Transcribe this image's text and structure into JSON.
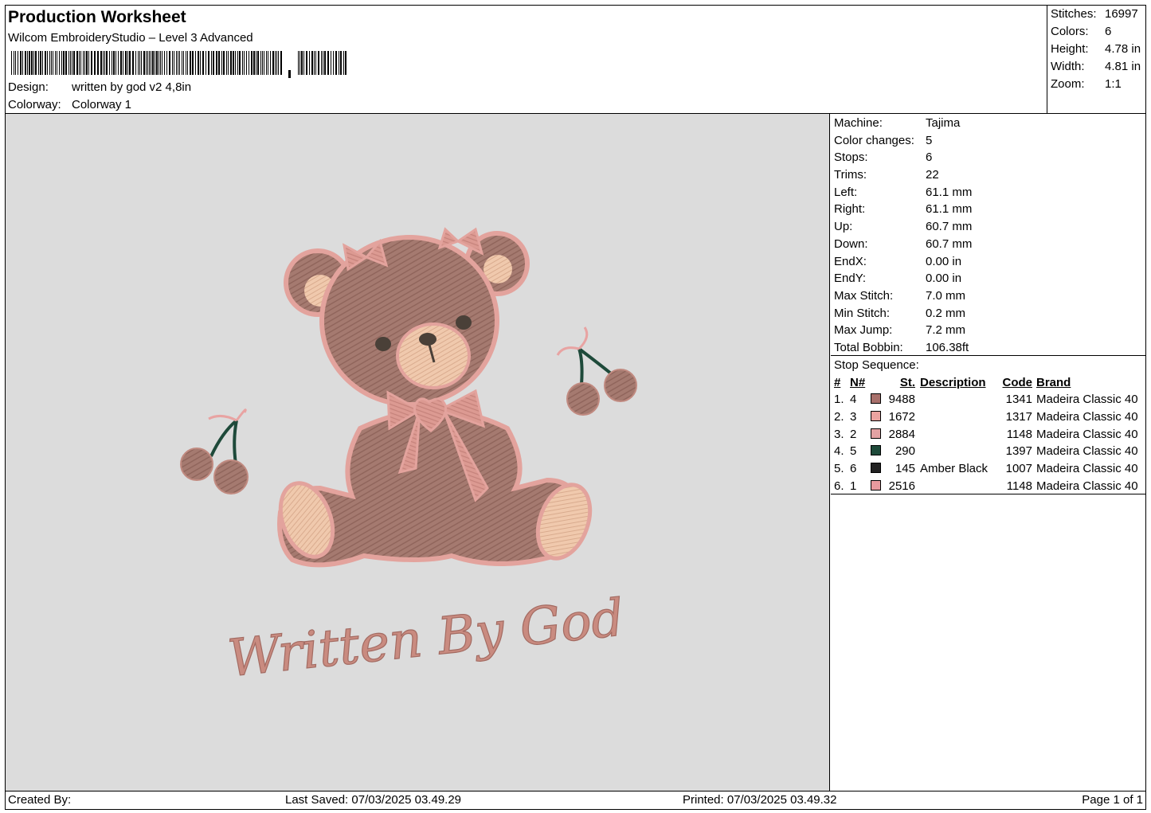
{
  "header": {
    "title": "Production Worksheet",
    "software": "Wilcom EmbroideryStudio – Level 3 Advanced",
    "design_label": "Design:",
    "design_value": "written by god v2 4,8in",
    "colorway_label": "Colorway:",
    "colorway_value": "Colorway 1"
  },
  "summary": {
    "stitches_label": "Stitches:",
    "stitches": "16997",
    "colors_label": "Colors:",
    "colors": "6",
    "height_label": "Height:",
    "height": "4.78 in",
    "width_label": "Width:",
    "width": "4.81 in",
    "zoom_label": "Zoom:",
    "zoom": "1:1"
  },
  "design_text": "Written By God",
  "machine": [
    {
      "label": "Machine:",
      "value": "Tajima"
    },
    {
      "label": "Color changes:",
      "value": "5"
    },
    {
      "label": "Stops:",
      "value": "6"
    },
    {
      "label": "Trims:",
      "value": "22"
    },
    {
      "label": "Left:",
      "value": "61.1 mm"
    },
    {
      "label": "Right:",
      "value": "61.1 mm"
    },
    {
      "label": "Up:",
      "value": "60.7 mm"
    },
    {
      "label": "Down:",
      "value": "60.7 mm"
    },
    {
      "label": "EndX:",
      "value": "0.00 in"
    },
    {
      "label": "EndY:",
      "value": "0.00 in"
    },
    {
      "label": "Max Stitch:",
      "value": "7.0 mm"
    },
    {
      "label": "Min Stitch:",
      "value": "0.2 mm"
    },
    {
      "label": "Max Jump:",
      "value": "7.2 mm"
    },
    {
      "label": "Total Bobbin:",
      "value": "106.38ft"
    }
  ],
  "stop_sequence": {
    "title": "Stop Sequence:",
    "headers": {
      "num": "#",
      "n": "N#",
      "st": "St.",
      "desc": "Description",
      "code": "Code",
      "brand": "Brand"
    },
    "rows": [
      {
        "num": "1.",
        "n": "4",
        "color": "#a8706b",
        "st": "9488",
        "desc": "",
        "code": "1341",
        "brand": "Madeira Classic 40"
      },
      {
        "num": "2.",
        "n": "3",
        "color": "#eba3a0",
        "st": "1672",
        "desc": "",
        "code": "1317",
        "brand": "Madeira Classic 40"
      },
      {
        "num": "3.",
        "n": "2",
        "color": "#e3a2a3",
        "st": "2884",
        "desc": "",
        "code": "1148",
        "brand": "Madeira Classic 40"
      },
      {
        "num": "4.",
        "n": "5",
        "color": "#1e4a3a",
        "st": "290",
        "desc": "",
        "code": "1397",
        "brand": "Madeira Classic 40"
      },
      {
        "num": "5.",
        "n": "6",
        "color": "#222222",
        "st": "145",
        "desc": "Amber Black",
        "code": "1007",
        "brand": "Madeira Classic 40"
      },
      {
        "num": "6.",
        "n": "1",
        "color": "#e89a9e",
        "st": "2516",
        "desc": "",
        "code": "1148",
        "brand": "Madeira Classic 40"
      }
    ]
  },
  "footer": {
    "created": "Created By:",
    "saved": "Last Saved: 07/03/2025 03.49.29",
    "printed": "Printed: 07/03/2025 03.49.32",
    "page": "Page 1 of 1"
  }
}
